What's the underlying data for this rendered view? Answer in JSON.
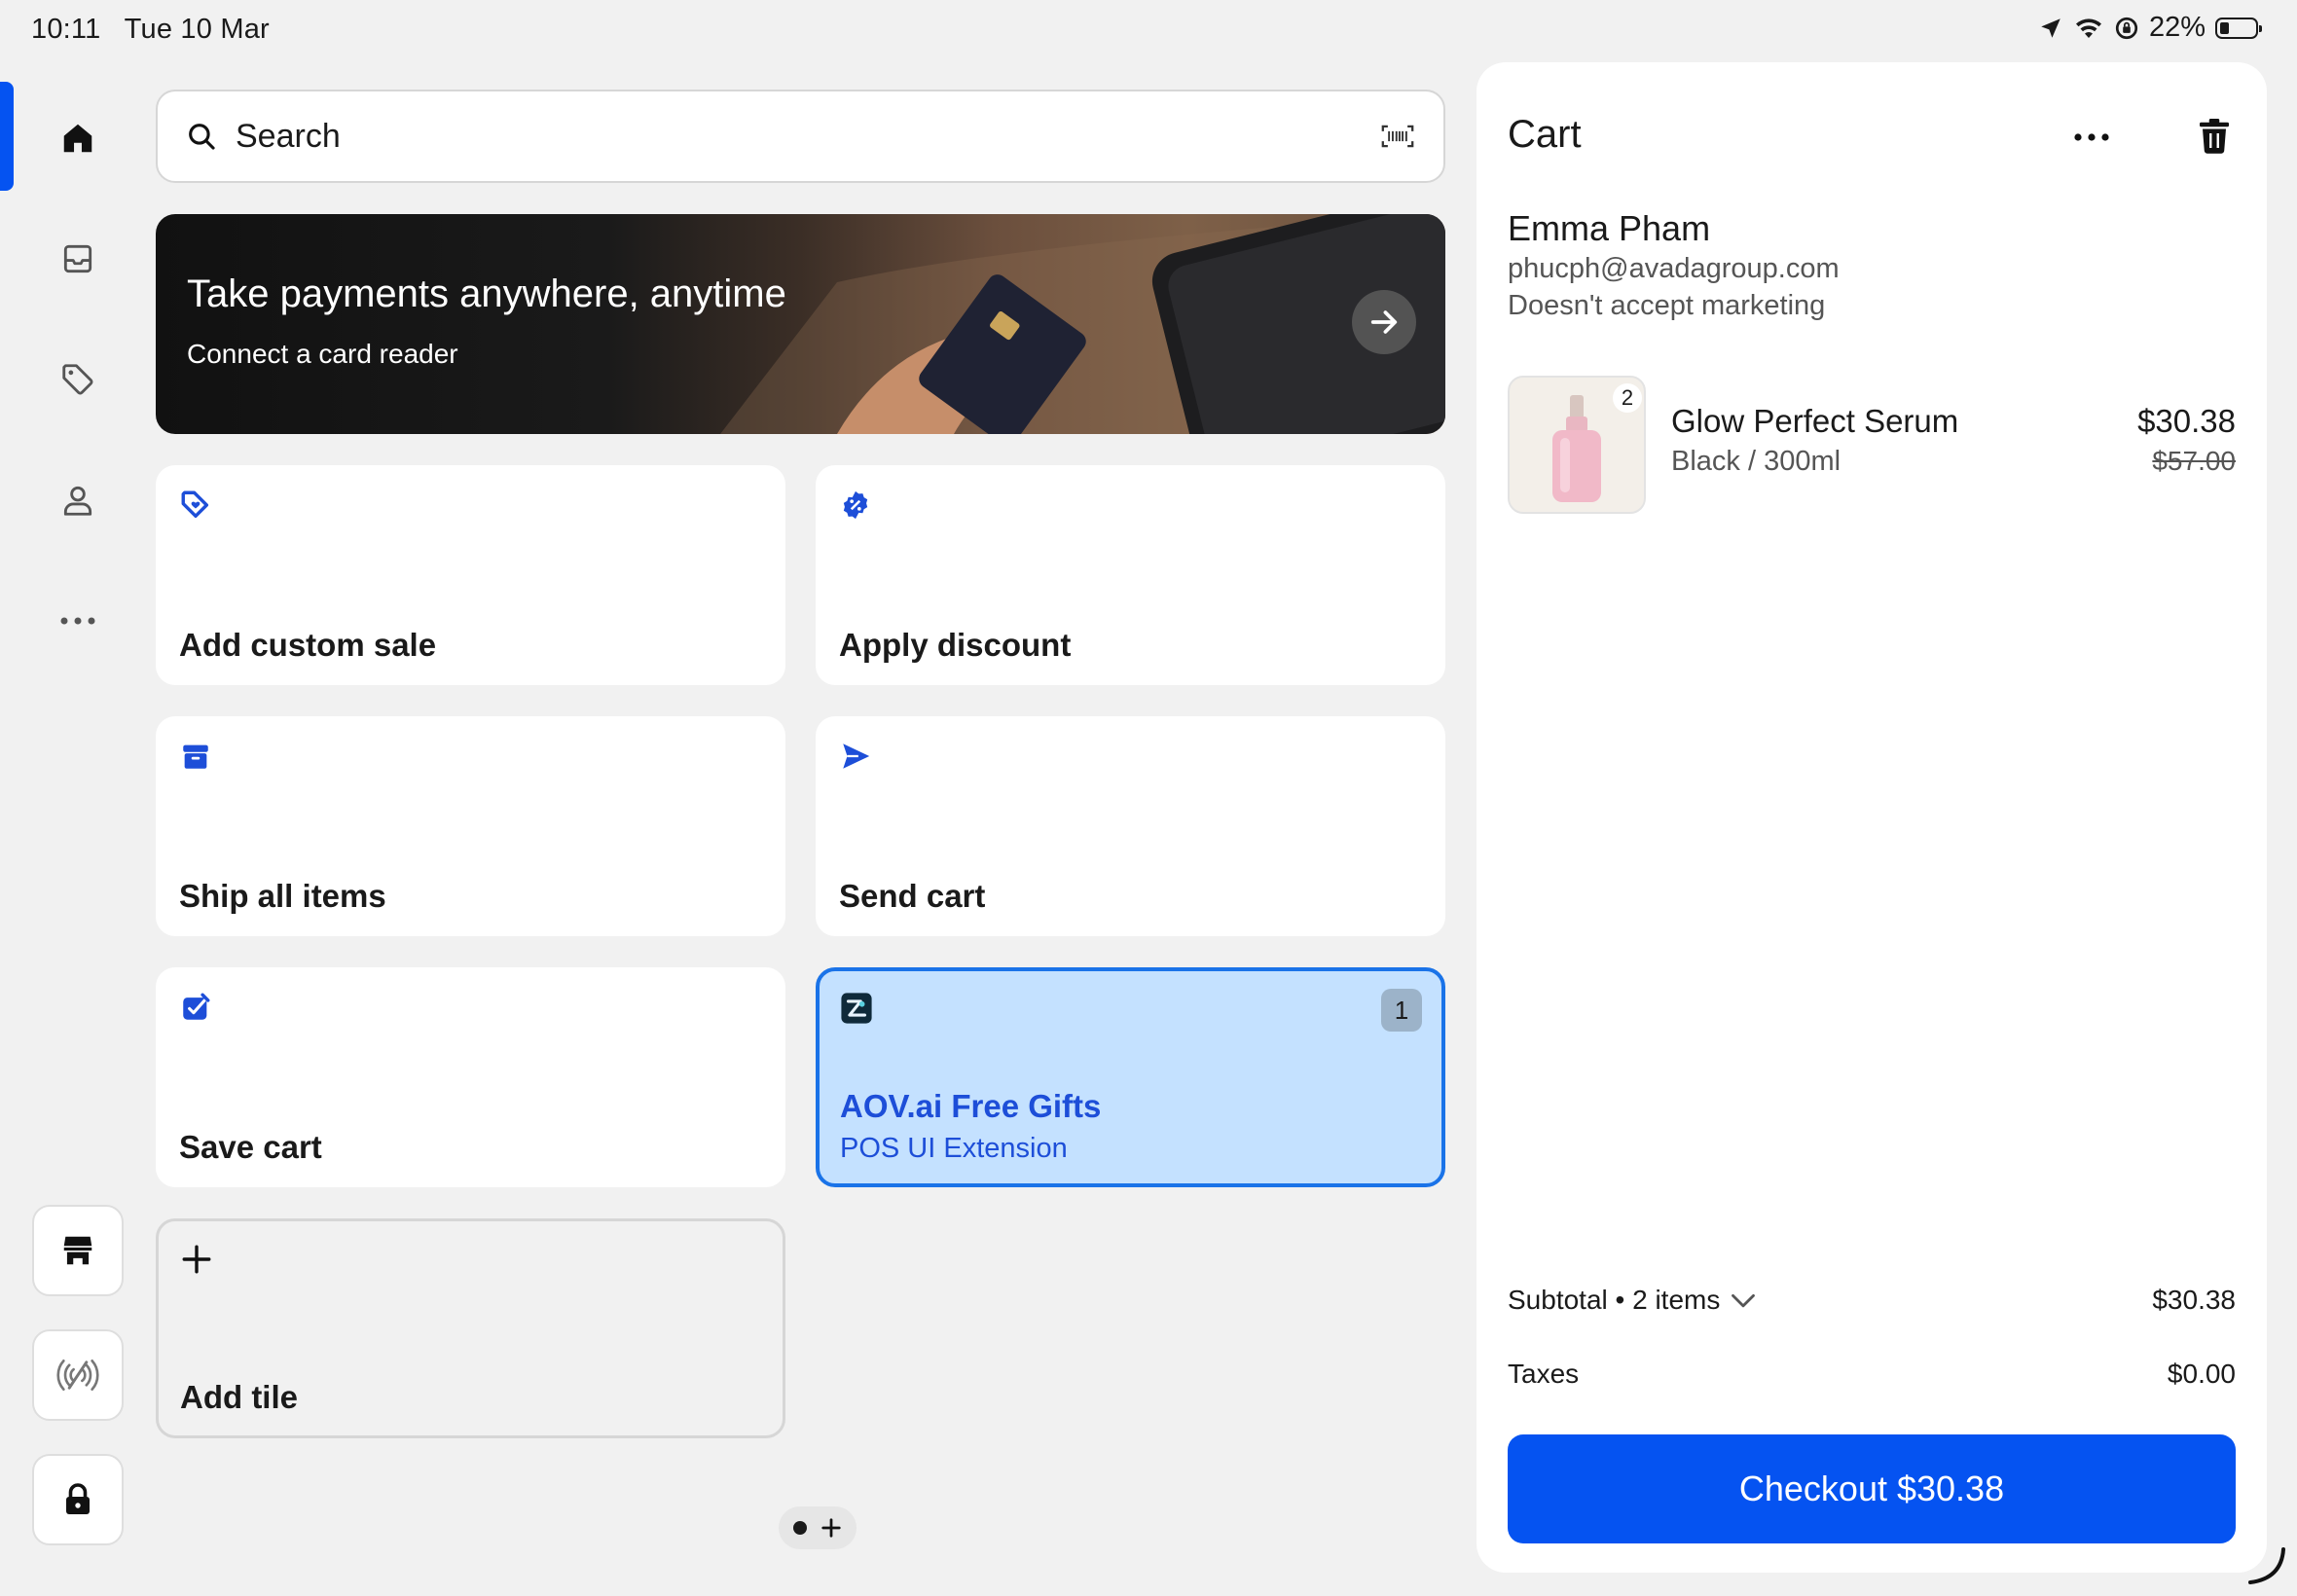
{
  "status_bar": {
    "time": "10:11",
    "date": "Tue 10 Mar",
    "battery": "22%"
  },
  "search": {
    "placeholder": "Search"
  },
  "banner": {
    "title": "Take payments anywhere, anytime",
    "subtitle": "Connect a card reader"
  },
  "tiles": {
    "custom_sale": "Add custom sale",
    "discount": "Apply discount",
    "ship": "Ship all items",
    "send": "Send cart",
    "save": "Save cart",
    "aov_title": "AOV.ai Free Gifts",
    "aov_sub": "POS UI Extension",
    "aov_badge": "1",
    "add_tile": "Add tile"
  },
  "cart": {
    "title": "Cart",
    "customer": {
      "name": "Emma Pham",
      "email": "phucph@avadagroup.com",
      "marketing": "Doesn't accept marketing"
    },
    "items": [
      {
        "name": "Glow Perfect Serum",
        "variant": "Black / 300ml",
        "price": "$30.38",
        "original_price": "$57.00",
        "quantity": "2"
      }
    ],
    "subtotal_label": "Subtotal • 2 items",
    "subtotal_value": "$30.38",
    "taxes_label": "Taxes",
    "taxes_value": "$0.00",
    "checkout_label": "Checkout  $30.38"
  },
  "colors": {
    "accent": "#0553f1",
    "aov_bg": "#c4e1ff",
    "icon_blue": "#1d4ed8"
  }
}
